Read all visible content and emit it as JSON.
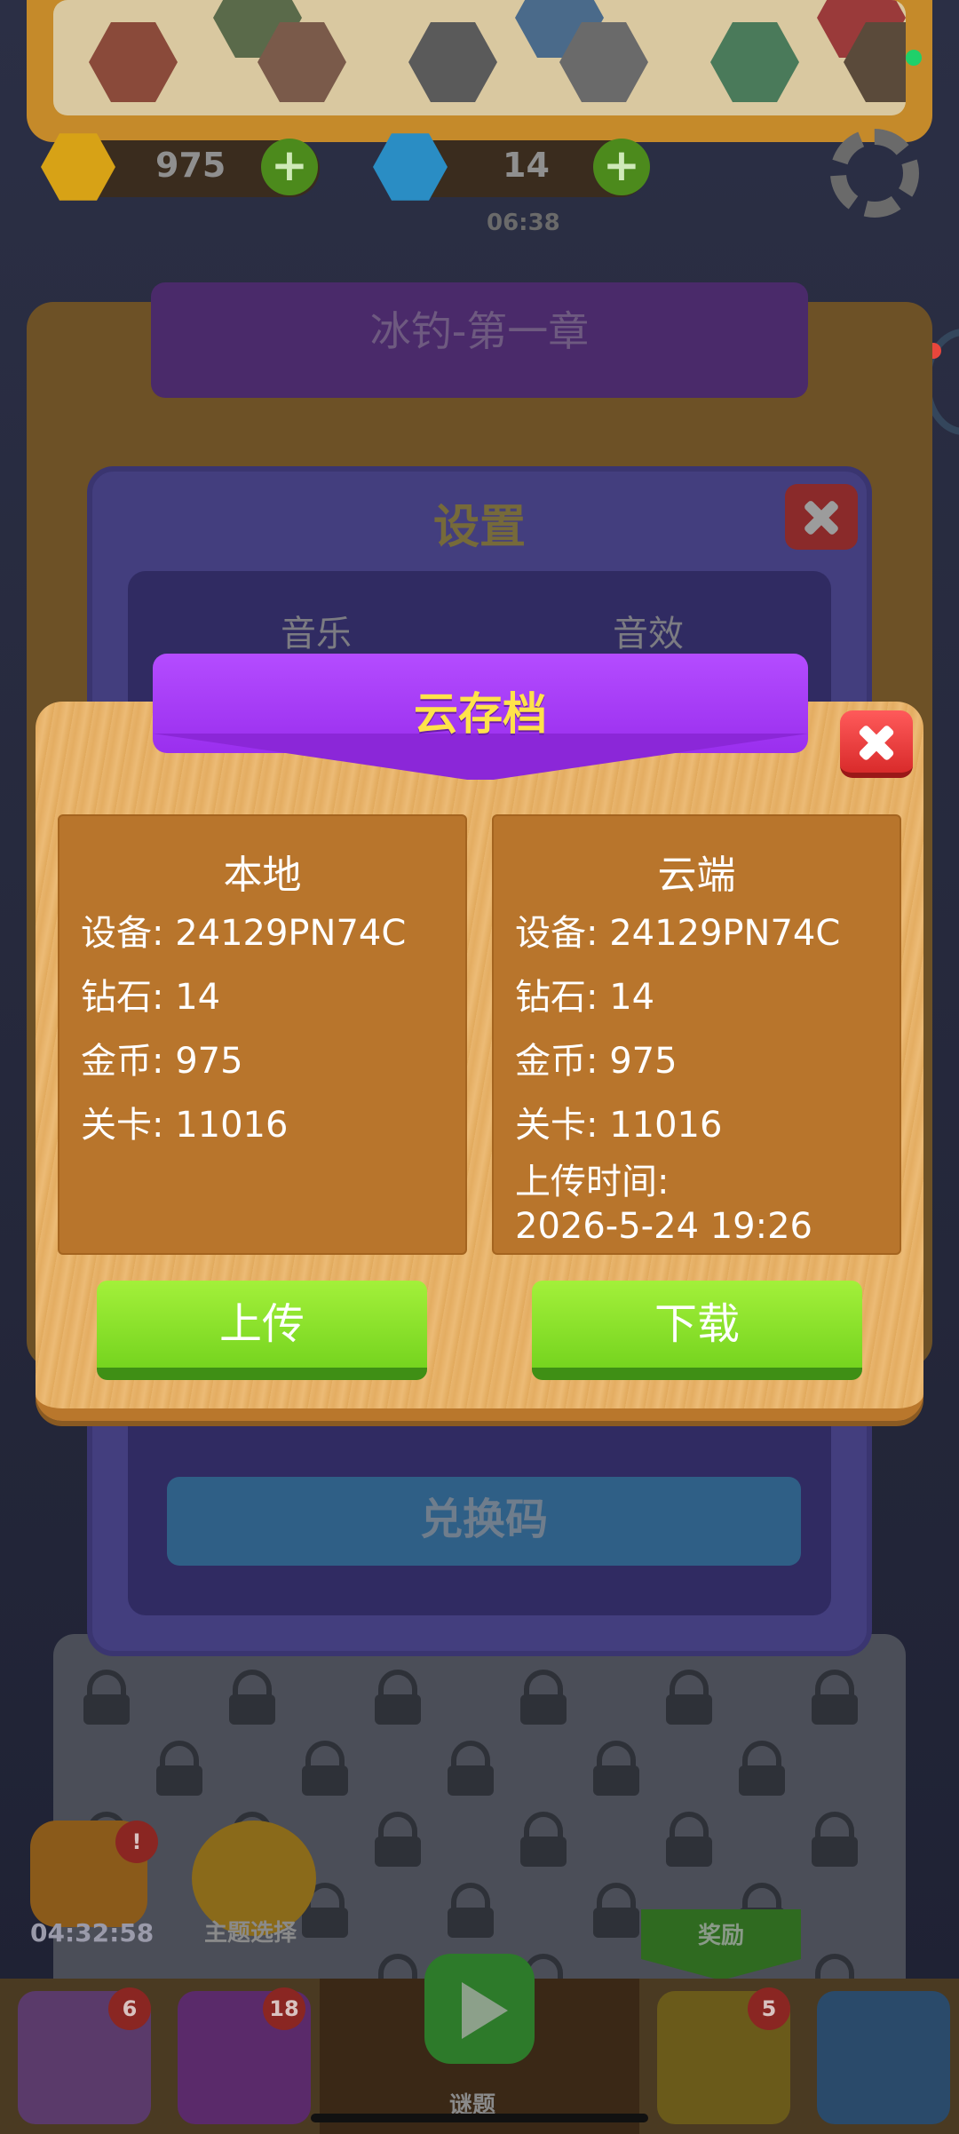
{
  "hud": {
    "coins": "975",
    "gems": "14",
    "timer": "06:38"
  },
  "chapter": {
    "title": "冰钓-第一章"
  },
  "settings": {
    "title": "设置",
    "tab_music": "音乐",
    "tab_sfx": "音效",
    "redeem_label": "兑换码"
  },
  "cloud_save": {
    "title": "云存档",
    "local": {
      "heading": "本地",
      "device": "设备: 24129PN74C",
      "gems": "钻石: 14",
      "coins": "金币: 975",
      "level": "关卡: 11016"
    },
    "cloud": {
      "heading": "云端",
      "device": "设备: 24129PN74C",
      "gems": "钻石: 14",
      "coins": "金币: 975",
      "level": "关卡: 11016",
      "upload_time_label": "上传时间:",
      "upload_time": "2026-5-24 19:26"
    },
    "upload_button": "上传",
    "download_button": "下载"
  },
  "side_widgets": {
    "event_timer": "04:32:58",
    "theme_select": "主题选择",
    "reward_label": "奖励"
  },
  "bottom_nav": {
    "shop_badge": "6",
    "puzzle_badge": "18",
    "play_label": "谜题",
    "star_badge": "5"
  },
  "colors": {
    "ribbon_purple": "#a53cf8",
    "title_yellow": "#ffe24a",
    "button_green": "#8ee22c",
    "close_red": "#e83434",
    "wood": "#e8b56e",
    "card_brown": "#b8752c"
  }
}
